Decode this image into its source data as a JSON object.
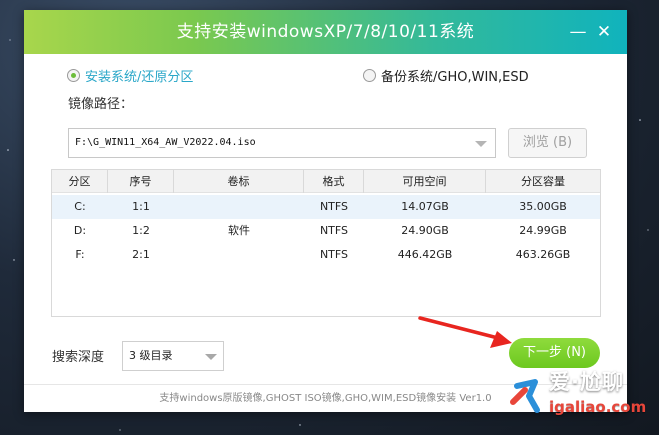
{
  "window": {
    "title": "支持安装windowsXP/7/8/10/11系统",
    "minimize_glyph": "—",
    "close_glyph": "✕"
  },
  "mode": {
    "install_label": "安装系统/还原分区",
    "backup_label": "备份系统/GHO,WIN,ESD",
    "selected": "install"
  },
  "image_path": {
    "label": "镜像路径：",
    "value": "F:\\G_WIN11_X64_AW_V2022.04.iso",
    "browse_label": "浏览 (B)"
  },
  "partition_table": {
    "columns": [
      "分区",
      "序号",
      "卷标",
      "格式",
      "可用空间",
      "分区容量"
    ],
    "rows": [
      {
        "partition": "C:",
        "index": "1:1",
        "label": "",
        "format": "NTFS",
        "free": "14.07GB",
        "capacity": "35.00GB",
        "selected": true
      },
      {
        "partition": "D:",
        "index": "1:2",
        "label": "软件",
        "format": "NTFS",
        "free": "24.90GB",
        "capacity": "24.99GB",
        "selected": false
      },
      {
        "partition": "F:",
        "index": "2:1",
        "label": "",
        "format": "NTFS",
        "free": "446.42GB",
        "capacity": "463.26GB",
        "selected": false
      }
    ]
  },
  "search_depth": {
    "label": "搜索深度",
    "value": "3 级目录"
  },
  "next_button": {
    "label": "下一步 (N)"
  },
  "footer": {
    "text": "支持windows原版镜像,GHOST ISO镜像,GHO,WIM,ESD镜像安装 Ver1.0"
  },
  "watermark": {
    "cn": "爱·尬聊",
    "url": "igaliao.com"
  },
  "colors": {
    "accent_green": "#6cc81f",
    "title_gradient_start": "#a8d64c",
    "title_gradient_end": "#10b3bd",
    "arrow_red": "#e8251f"
  }
}
